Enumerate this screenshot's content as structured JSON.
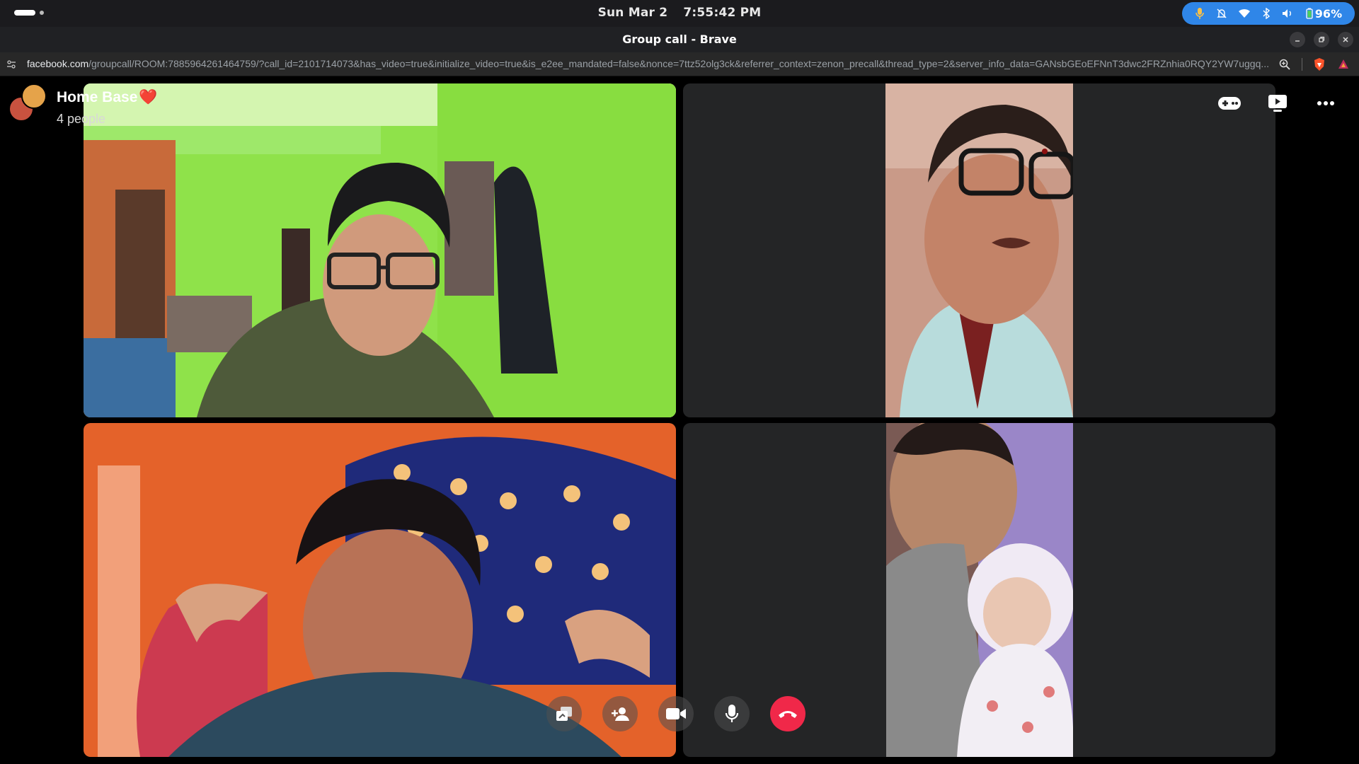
{
  "system": {
    "date": "Sun Mar 2",
    "time": "7:55:42 PM",
    "battery": "96%",
    "tray_icons": [
      "microphone-icon",
      "notifications-off-icon",
      "wifi-icon",
      "bluetooth-icon",
      "volume-icon",
      "battery-icon"
    ]
  },
  "window": {
    "title": "Group call - Brave"
  },
  "urlbar": {
    "domain": "facebook.com",
    "path": "/groupcall/ROOM:7885964261464759/?call_id=2101714073&has_video=true&initialize_video=true&is_e2ee_mandated=false&nonce=7ttz52olg3ck&referrer_context=zenon_precall&thread_type=2&server_info_data=GANsbGEoEFNnT3dwc2FRZnhia0RQY2YW7uggq..."
  },
  "call": {
    "group_name": "Home Base",
    "group_emoji": "❤️",
    "people_count": "4 people",
    "participants": [
      {
        "id": "p1",
        "active_speaker": true
      },
      {
        "id": "p2",
        "active_speaker": false
      },
      {
        "id": "p3",
        "active_speaker": false
      },
      {
        "id": "p4",
        "active_speaker": false
      }
    ],
    "top_actions": [
      "games-icon",
      "watch-together-icon",
      "more-options-icon"
    ],
    "controls": [
      "share-screen-icon",
      "add-people-icon",
      "camera-icon",
      "microphone-icon",
      "end-call-icon"
    ]
  },
  "colors": {
    "tray_accent": "#2f86e8",
    "end_call": "#f02849",
    "tile_bg": "#242526"
  }
}
